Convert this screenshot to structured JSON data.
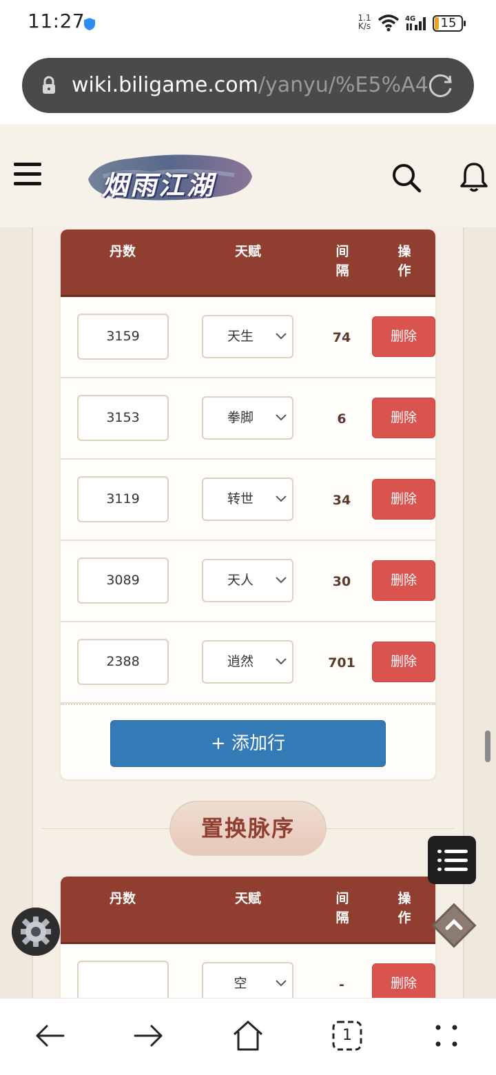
{
  "status_bar": {
    "time": "11:27",
    "net_speed_value": "1.1",
    "net_speed_unit": "K/s",
    "network_type": "4G",
    "battery": "15"
  },
  "browser": {
    "url_host": "wiki.biligame.com",
    "url_path": "/yanyu/%E5%A4"
  },
  "site": {
    "logo_text": "烟雨江湖"
  },
  "table1": {
    "headers": {
      "dan": "丹数",
      "talent": "天赋",
      "interval_1": "间",
      "interval_2": "隔",
      "action_1": "操",
      "action_2": "作"
    },
    "rows": [
      {
        "dan": "3159",
        "talent": "天生",
        "interval": "74",
        "delete": "删除"
      },
      {
        "dan": "3153",
        "talent": "拳脚",
        "interval": "6",
        "delete": "删除"
      },
      {
        "dan": "3119",
        "talent": "转世",
        "interval": "34",
        "delete": "删除"
      },
      {
        "dan": "3089",
        "talent": "天人",
        "interval": "30",
        "delete": "删除"
      },
      {
        "dan": "2388",
        "talent": "逍然",
        "interval": "701",
        "delete": "删除"
      }
    ],
    "add_row_label": "+ 添加行"
  },
  "section2": {
    "title": "置换脉序"
  },
  "table2": {
    "headers": {
      "dan": "丹数",
      "talent": "天赋",
      "interval_1": "间",
      "interval_2": "隔",
      "action_1": "操",
      "action_2": "作"
    },
    "rows": [
      {
        "dan": "",
        "talent": "空",
        "interval": "-",
        "delete": "删除"
      }
    ]
  },
  "bottom_nav": {
    "tab_count": "1"
  },
  "colors": {
    "header_red": "#8f3e30",
    "delete_red": "#d9534f",
    "add_blue": "#337ab7",
    "page_bg": "#f5efe5"
  },
  "icons": [
    "shield-icon",
    "wifi-icon",
    "signal-icon",
    "battery-icon",
    "lock-icon",
    "reload-icon",
    "menu-icon",
    "search-icon",
    "bell-icon",
    "chevron-down-icon",
    "list-icon",
    "settings-gear-icon",
    "scroll-up-icon",
    "back-arrow-icon",
    "forward-arrow-icon",
    "home-icon",
    "tabs-icon",
    "more-icon"
  ]
}
